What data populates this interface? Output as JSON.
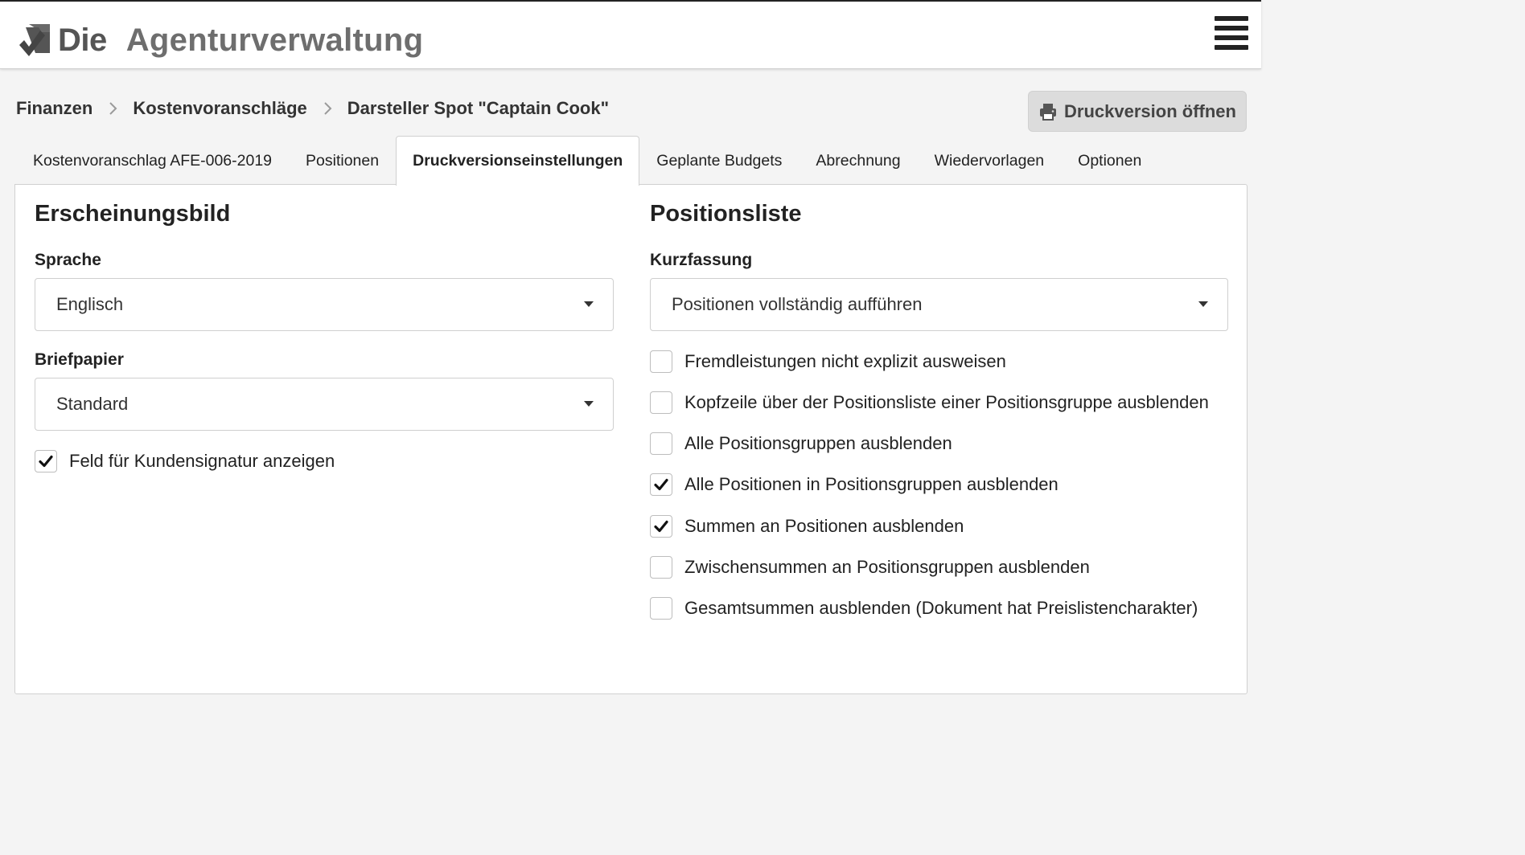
{
  "header": {
    "logo_prefix": "Die",
    "logo_name": "Agenturverwaltung",
    "logo_icon": "logo-icon",
    "menu_icon": "hamburger-menu-icon"
  },
  "breadcrumb": {
    "items": [
      "Finanzen",
      "Kostenvoranschläge",
      "Darsteller Spot \"Captain Cook\""
    ],
    "separator_icon": "chevron-right-icon"
  },
  "actions": {
    "print_label": "Druckversion öffnen",
    "print_icon": "printer-icon"
  },
  "tabs": [
    {
      "label": "Kostenvoranschlag AFE-006-2019",
      "active": false
    },
    {
      "label": "Positionen",
      "active": false
    },
    {
      "label": "Druckversionseinstellungen",
      "active": true
    },
    {
      "label": "Geplante Budgets",
      "active": false
    },
    {
      "label": "Abrechnung",
      "active": false
    },
    {
      "label": "Wiedervorlagen",
      "active": false
    },
    {
      "label": "Optionen",
      "active": false
    }
  ],
  "appearance": {
    "title": "Erscheinungsbild",
    "language_label": "Sprache",
    "language_value": "Englisch",
    "letterhead_label": "Briefpapier",
    "letterhead_value": "Standard",
    "signature_label": "Feld für Kundensignatur anzeigen",
    "signature_checked": true
  },
  "position_list": {
    "title": "Positionsliste",
    "summary_label": "Kurzfassung",
    "summary_value": "Positionen vollständig aufführen",
    "options": [
      {
        "label": "Fremdleistungen nicht explizit ausweisen",
        "checked": false
      },
      {
        "label": "Kopfzeile über der Positionsliste einer Positionsgruppe ausblenden",
        "checked": false
      },
      {
        "label": "Alle Positionsgruppen ausblenden",
        "checked": false
      },
      {
        "label": "Alle Positionen in Positionsgruppen ausblenden",
        "checked": true
      },
      {
        "label": "Summen an Positionen ausblenden",
        "checked": true
      },
      {
        "label": "Zwischensummen an Positionsgruppen ausblenden",
        "checked": false
      },
      {
        "label": "Gesamtsummen ausblenden (Dokument hat Preislistencharakter)",
        "checked": false
      }
    ]
  },
  "colors": {
    "page_background": "#f4f4f4",
    "panel_background": "#ffffff",
    "button_background": "#dcdcdc",
    "text": "#222222",
    "check": "#111111"
  }
}
